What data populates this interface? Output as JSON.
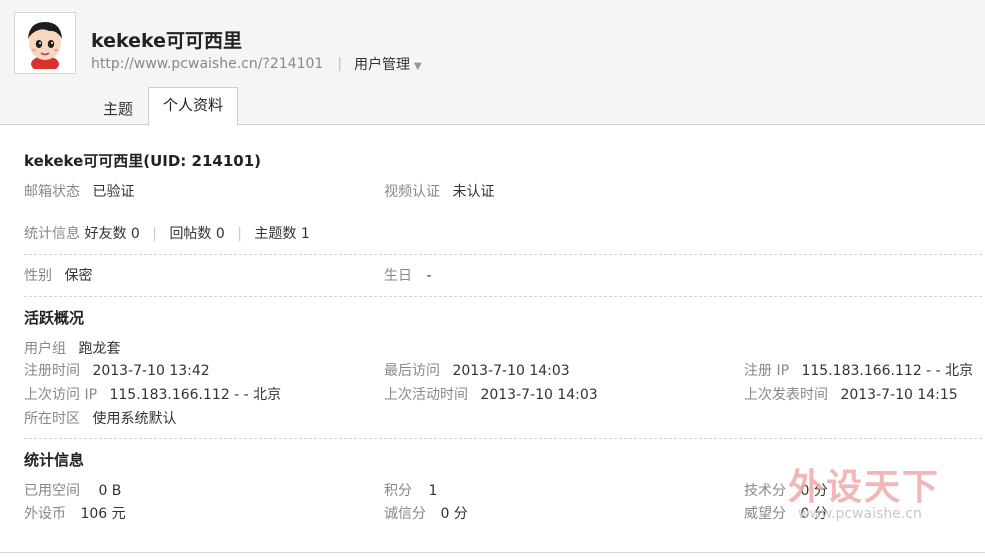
{
  "header": {
    "username": "kekeke可可西里",
    "url": "http://www.pcwaishe.cn/?214101",
    "separator": "|",
    "user_management": "用户管理"
  },
  "tabs": [
    {
      "label": "主题",
      "active": false
    },
    {
      "label": "个人资料",
      "active": true
    }
  ],
  "profile": {
    "name_uid": "kekeke可可西里(UID: 214101)",
    "email_status_label": "邮箱状态",
    "email_status_value": "已验证",
    "video_auth_label": "视频认证",
    "video_auth_value": "未认证",
    "stats_label": "统计信息",
    "friends": "好友数 0",
    "replies": "回帖数 0",
    "topics": "主题数 1",
    "gender_label": "性别",
    "gender_value": "保密",
    "birthday_label": "生日",
    "birthday_value": "-"
  },
  "activity": {
    "title": "活跃概况",
    "usergroup_label": "用户组",
    "usergroup_value": "跑龙套",
    "reg_time_label": "注册时间",
    "reg_time_value": "2013-7-10 13:42",
    "last_visit_label": "最后访问",
    "last_visit_value": "2013-7-10 14:03",
    "reg_ip_label": "注册 IP",
    "reg_ip_value": "115.183.166.112 - - 北京",
    "last_ip_label": "上次访问 IP",
    "last_ip_value": "115.183.166.112 - - 北京",
    "last_active_label": "上次活动时间",
    "last_active_value": "2013-7-10 14:03",
    "last_post_label": "上次发表时间",
    "last_post_value": "2013-7-10 14:15",
    "timezone_label": "所在时区",
    "timezone_value": "使用系统默认"
  },
  "stats": {
    "title": "统计信息",
    "space_label": "已用空间",
    "space_value": "0 B",
    "points_label": "积分",
    "points_value": "1",
    "tech_label": "技术分",
    "tech_value": "0 分",
    "coins_label": "外设币",
    "coins_value": "106 元",
    "credit_label": "诚信分",
    "credit_value": "0 分",
    "prestige_label": "威望分",
    "prestige_value": "0 分"
  },
  "watermark": {
    "logo_text": "外设天下",
    "site": "www.pcwaishe.cn"
  }
}
